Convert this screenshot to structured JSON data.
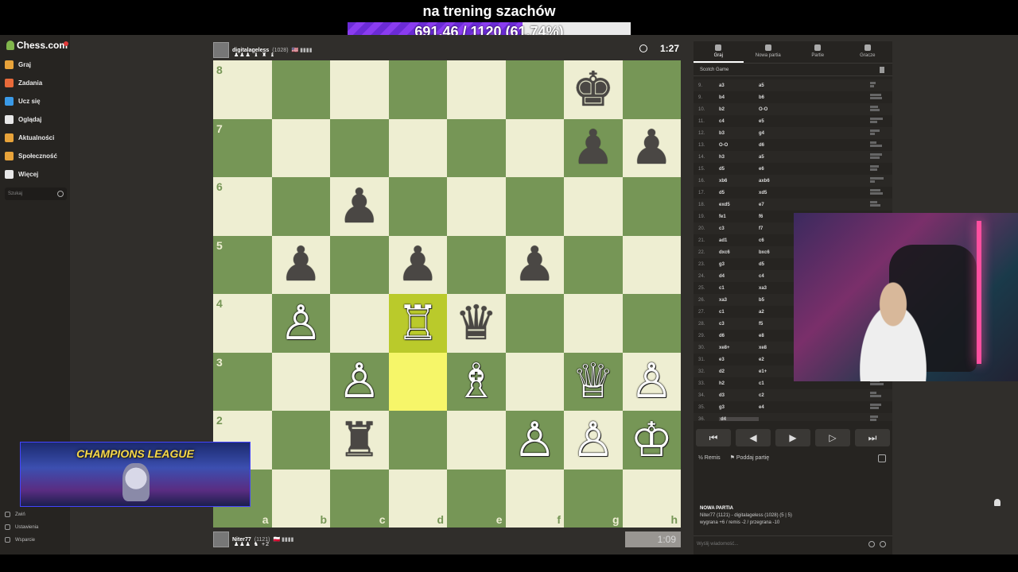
{
  "overlay": {
    "title": "na trening szachów",
    "goal_text": "691.46 / 1120 (61.74%)",
    "goal_progress": 0.6174
  },
  "sidebar": {
    "logo": "Chess.com",
    "items": [
      {
        "label": "Graj",
        "icon": "pawn-icon",
        "color": "#e8a33a"
      },
      {
        "label": "Zadania",
        "icon": "puzzle-icon",
        "color": "#e86a3a"
      },
      {
        "label": "Ucz się",
        "icon": "lesson-icon",
        "color": "#3a9ae8"
      },
      {
        "label": "Oglądaj",
        "icon": "watch-icon",
        "color": "#e8e8e8"
      },
      {
        "label": "Aktualności",
        "icon": "news-icon",
        "color": "#e8a33a"
      },
      {
        "label": "Społeczność",
        "icon": "community-icon",
        "color": "#e8a33a"
      },
      {
        "label": "Więcej",
        "icon": "more-icon",
        "color": "#e8e8e8"
      }
    ],
    "search_placeholder": "Szukaj",
    "bottom": [
      "Zwiń",
      "Ustawienia",
      "Wsparcie"
    ]
  },
  "player_top": {
    "name": "digitalageless",
    "rating": "(1028)",
    "flags": "🇺🇸 ▮▮▮▮",
    "captures": "♟♟♟ ♝ ♜ ♝",
    "clock": "1:27"
  },
  "player_bottom": {
    "name": "Niter77",
    "rating": "(1121)",
    "flags": "🇵🇱 ▮▮▮▮",
    "captures": "♟♟♟ ♞ +2",
    "clock": "1:09"
  },
  "board": {
    "files": [
      "a",
      "b",
      "c",
      "d",
      "e",
      "f",
      "g",
      "h"
    ],
    "ranks": [
      "8",
      "7",
      "6",
      "5",
      "4",
      "3",
      "2",
      "1"
    ],
    "highlight": [
      "d4",
      "d3"
    ],
    "pieces": [
      {
        "sq": "g8",
        "glyph": "♚",
        "color": "black"
      },
      {
        "sq": "g7",
        "glyph": "♟",
        "color": "black"
      },
      {
        "sq": "h7",
        "glyph": "♟",
        "color": "black"
      },
      {
        "sq": "c6",
        "glyph": "♟",
        "color": "black"
      },
      {
        "sq": "b5",
        "glyph": "♟",
        "color": "black"
      },
      {
        "sq": "d5",
        "glyph": "♟",
        "color": "black"
      },
      {
        "sq": "f5",
        "glyph": "♟",
        "color": "black"
      },
      {
        "sq": "b4",
        "glyph": "♙",
        "color": "white"
      },
      {
        "sq": "d4",
        "glyph": "♖",
        "color": "white"
      },
      {
        "sq": "e4",
        "glyph": "♛",
        "color": "black"
      },
      {
        "sq": "c3",
        "glyph": "♙",
        "color": "white"
      },
      {
        "sq": "e3",
        "glyph": "♗",
        "color": "white"
      },
      {
        "sq": "g3",
        "glyph": "♕",
        "color": "white"
      },
      {
        "sq": "h3",
        "glyph": "♙",
        "color": "white"
      },
      {
        "sq": "c2",
        "glyph": "♜",
        "color": "black"
      },
      {
        "sq": "f2",
        "glyph": "♙",
        "color": "white"
      },
      {
        "sq": "g2",
        "glyph": "♙",
        "color": "white"
      },
      {
        "sq": "h2",
        "glyph": "♔",
        "color": "white"
      }
    ]
  },
  "panel": {
    "tabs": [
      {
        "label": "Graj",
        "active": true
      },
      {
        "label": "Nowa partia",
        "active": false
      },
      {
        "label": "Partie",
        "active": false
      },
      {
        "label": "Gracze",
        "active": false
      }
    ],
    "opening": "Scotch Game",
    "moves": [
      {
        "n": "9.",
        "w": "a3",
        "b": "a5"
      },
      {
        "n": "9.",
        "w": "b4",
        "b": "b6"
      },
      {
        "n": "10.",
        "w": "b2",
        "b": "O-O"
      },
      {
        "n": "11.",
        "w": "c4",
        "b": "e5"
      },
      {
        "n": "12.",
        "w": "b3",
        "b": "g4"
      },
      {
        "n": "13.",
        "w": "O-O",
        "b": "d6"
      },
      {
        "n": "14.",
        "w": "h3",
        "b": "a5"
      },
      {
        "n": "15.",
        "w": "d5",
        "b": "e6"
      },
      {
        "n": "16.",
        "w": "xb6",
        "b": "axb6"
      },
      {
        "n": "17.",
        "w": "d5",
        "b": "xd5"
      },
      {
        "n": "18.",
        "w": "exd5",
        "b": "e7"
      },
      {
        "n": "19.",
        "w": "fe1",
        "b": "f6"
      },
      {
        "n": "20.",
        "w": "c3",
        "b": "f7"
      },
      {
        "n": "21.",
        "w": "ad1",
        "b": "c6"
      },
      {
        "n": "22.",
        "w": "dxc6",
        "b": "bxc6"
      },
      {
        "n": "23.",
        "w": "g3",
        "b": "d5"
      },
      {
        "n": "24.",
        "w": "d4",
        "b": "c4"
      },
      {
        "n": "25.",
        "w": "c1",
        "b": "xa3"
      },
      {
        "n": "26.",
        "w": "xa3",
        "b": "b5"
      },
      {
        "n": "27.",
        "w": "c1",
        "b": "a2"
      },
      {
        "n": "28.",
        "w": "c3",
        "b": "f5"
      },
      {
        "n": "29.",
        "w": "d6",
        "b": "e8"
      },
      {
        "n": "30.",
        "w": "xe8+",
        "b": "xe8"
      },
      {
        "n": "31.",
        "w": "e3",
        "b": "e2"
      },
      {
        "n": "32.",
        "w": "d2",
        "b": "e1+"
      },
      {
        "n": "33.",
        "w": "h2",
        "b": "c1"
      },
      {
        "n": "34.",
        "w": "d3",
        "b": "c2"
      },
      {
        "n": "35.",
        "w": "g3",
        "b": "e4"
      },
      {
        "n": "36.",
        "w": "d4",
        "b": ""
      }
    ],
    "controls": [
      "⏮",
      "◀",
      "▶",
      "▷",
      "⏭"
    ],
    "draw_label": "Remis",
    "resign_label": "Poddaj partię",
    "newgame_title": "NOWA PARTIA",
    "newgame_line1": "Niter77 (1121) - digitalageless (1028) (5 | 5)",
    "newgame_line2": "wygrana +6 / remis -2 / przegrana -10",
    "chat_placeholder": "Wyślij wiadomość..."
  },
  "banner": {
    "title": "CHAMPIONS LEAGUE"
  }
}
